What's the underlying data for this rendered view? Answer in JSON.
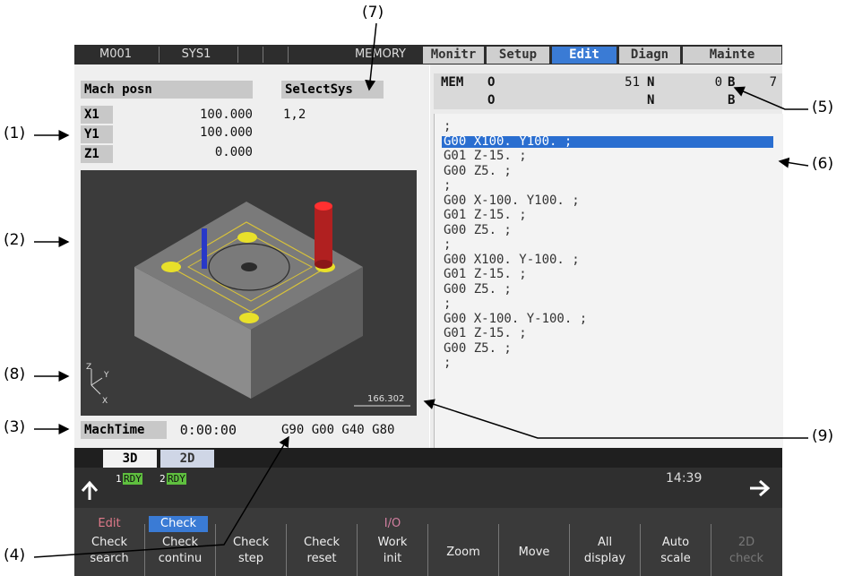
{
  "callouts": [
    "(1)",
    "(2)",
    "(3)",
    "(4)",
    "(5)",
    "(6)",
    "(7)",
    "(8)",
    "(9)"
  ],
  "topbar": {
    "machine": "M001",
    "system": "SYS1",
    "mode": "MEMORY",
    "tabs": [
      "Monitr",
      "Setup",
      "Edit",
      "Diagn",
      "Mainte"
    ],
    "active_tab": "Edit"
  },
  "left": {
    "mach_posn_label": "Mach posn",
    "select_sys_label": "SelectSys",
    "select_sys_value": "1,2",
    "axes": [
      {
        "name": "X1",
        "value": "100.000"
      },
      {
        "name": "Y1",
        "value": "100.000"
      },
      {
        "name": "Z1",
        "value": "0.000"
      }
    ],
    "scale_value": "166.302",
    "axis_z": "Z",
    "axis_y": "Y",
    "axis_x": "X",
    "mach_time_label": "MachTime",
    "mach_time_value": "0:00:00",
    "modal": "G90 G00 G40 G80"
  },
  "right": {
    "mem_label": "MEM",
    "row1": {
      "o_label": "O",
      "o_value": "51",
      "n_label": "N",
      "n_value": "0",
      "b_label": "B",
      "b_value": "7"
    },
    "row2": {
      "o_label": "O",
      "n_label": "N",
      "b_label": "B"
    },
    "program": [
      ";",
      "G00 X100. Y100. ;",
      "G01 Z-15. ;",
      "G00 Z5. ;",
      ";",
      "G00 X-100. Y100. ;",
      "G01 Z-15. ;",
      "G00 Z5. ;",
      ";",
      "G00 X100. Y-100. ;",
      "G01 Z-15. ;",
      "G00 Z5. ;",
      ";",
      "G00 X-100. Y-100. ;",
      "G01 Z-15. ;",
      "G00 Z5. ;",
      ";"
    ],
    "selected_line": 1
  },
  "view_tabs": [
    "3D",
    "2D"
  ],
  "status": {
    "sys1_num": "1",
    "sys1_state": "RDY",
    "sys2_num": "2",
    "sys2_state": "RDY",
    "time": "14:39"
  },
  "menu": {
    "group_labels": {
      "edit": "Edit",
      "check": "Check",
      "io": "I/O"
    },
    "keys": [
      {
        "line1": "Check",
        "line2": "search"
      },
      {
        "line1": "Check",
        "line2": "continu"
      },
      {
        "line1": "Check",
        "line2": "step"
      },
      {
        "line1": "Check",
        "line2": "reset"
      },
      {
        "line1": "Work",
        "line2": "init"
      },
      {
        "line1": "Zoom",
        "line2": ""
      },
      {
        "line1": "Move",
        "line2": ""
      },
      {
        "line1": "All",
        "line2": "display"
      },
      {
        "line1": "Auto",
        "line2": "scale"
      },
      {
        "line1": "2D",
        "line2": "check"
      }
    ]
  },
  "colors": {
    "accent_blue": "#3a7bd5",
    "rdy_green": "#5fbf3f",
    "edit_pink": "#e07a8a",
    "io_pink": "#d27fa0"
  }
}
